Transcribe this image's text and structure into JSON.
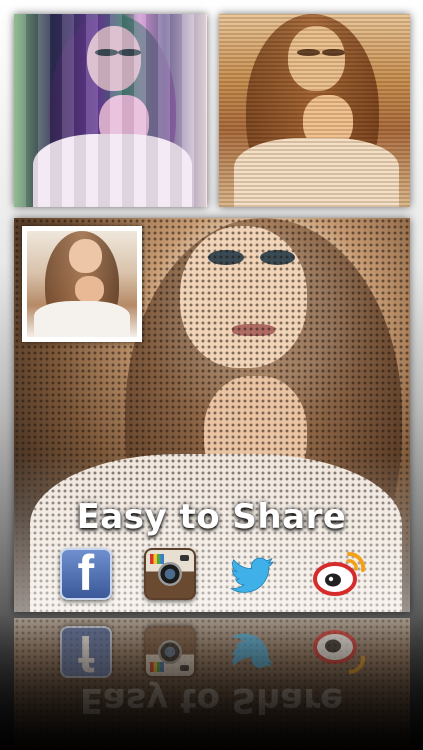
{
  "headline": "Easy to Share",
  "share_targets": [
    {
      "name": "Facebook",
      "glyph": "f",
      "icon": "facebook-icon",
      "color": "#3b5998"
    },
    {
      "name": "Instagram",
      "icon": "instagram-icon",
      "color": "#6b4a32"
    },
    {
      "name": "Twitter",
      "icon": "twitter-icon",
      "color": "#3fb1e8"
    },
    {
      "name": "Weibo",
      "icon": "weibo-icon",
      "color": "#d52b2b"
    }
  ],
  "photos": [
    {
      "id": "top-left",
      "filter": "color-stripes"
    },
    {
      "id": "top-right",
      "filter": "warm-scanlines"
    },
    {
      "id": "main",
      "filter": "halftone"
    },
    {
      "id": "inset",
      "filter": "original"
    }
  ]
}
